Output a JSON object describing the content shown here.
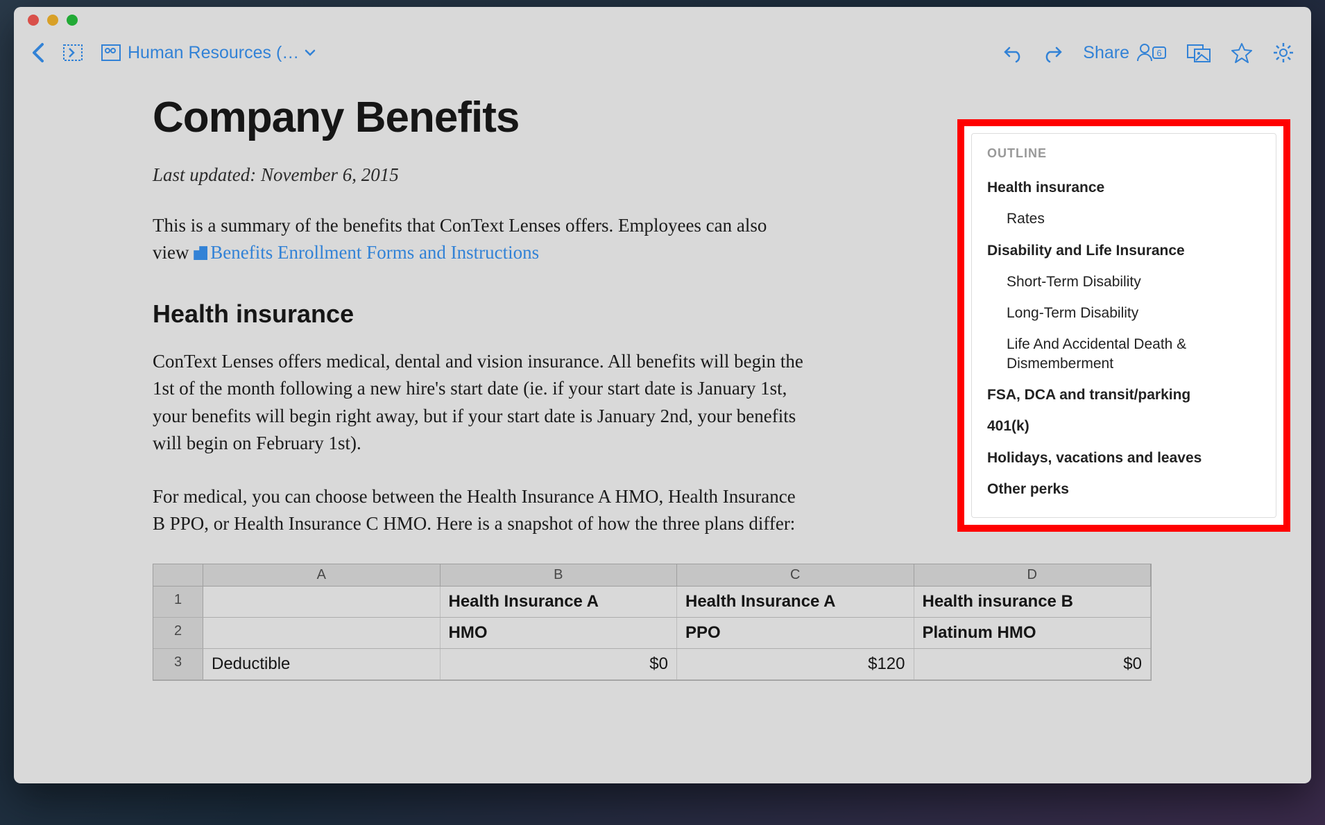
{
  "toolbar": {
    "breadcrumb": "Human Resources (…",
    "share_label": "Share",
    "share_count": "6"
  },
  "doc": {
    "title": "Company Benefits",
    "last_updated": "Last updated: November 6, 2015",
    "intro_prefix": "This is a summary of the benefits that ConText Lenses offers. Employees can also view ",
    "intro_link": "Benefits Enrollment Forms and Instructions",
    "h1": "Health insurance",
    "p1": "ConText Lenses offers medical, dental and vision insurance. All benefits will begin the 1st of the month following a new hire's start date (ie. if your start date is January 1st, your benefits will begin right away, but if your start date is January 2nd, your benefits will begin on February 1st).",
    "p2": "For medical, you can choose between the Health Insurance A HMO, Health Insurance B PPO, or Health Insurance C HMO. Here is a snapshot of how the three plans differ:"
  },
  "outline": {
    "title": "OUTLINE",
    "items": [
      {
        "label": "Health insurance",
        "level": 1
      },
      {
        "label": "Rates",
        "level": 2
      },
      {
        "label": "Disability and Life Insurance",
        "level": 1
      },
      {
        "label": "Short-Term Disability",
        "level": 2
      },
      {
        "label": "Long-Term Disability",
        "level": 2
      },
      {
        "label": "Life And Accidental Death & Dismemberment",
        "level": 2
      },
      {
        "label": "FSA, DCA and transit/parking",
        "level": 1
      },
      {
        "label": "401(k)",
        "level": 1
      },
      {
        "label": "Holidays, vacations and leaves",
        "level": 1
      },
      {
        "label": "Other perks",
        "level": 1
      }
    ]
  },
  "sheet": {
    "columns": [
      "A",
      "B",
      "C",
      "D"
    ],
    "rows": [
      {
        "num": "1",
        "cells": [
          "",
          "Health Insurance A",
          "Health Insurance A",
          "Health insurance B"
        ],
        "bold": true
      },
      {
        "num": "2",
        "cells": [
          "",
          "HMO",
          "PPO",
          "Platinum HMO"
        ],
        "bold": true
      },
      {
        "num": "3",
        "cells": [
          "Deductible",
          "$0",
          "$120",
          "$0"
        ],
        "bold": false
      }
    ]
  }
}
